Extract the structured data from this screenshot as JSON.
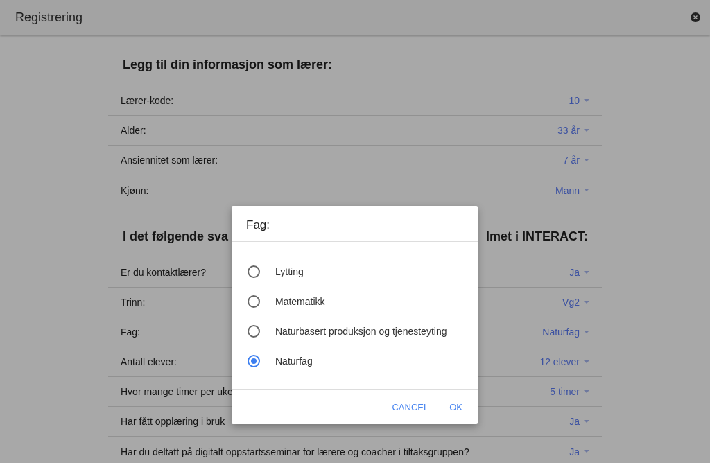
{
  "window": {
    "title": "Registrering"
  },
  "sections": [
    {
      "heading": [
        "Legg til din informasjon som lærer:"
      ],
      "rows": [
        {
          "label": "Lærer-kode:",
          "value": "10"
        },
        {
          "label": "Alder:",
          "value": "33 år"
        },
        {
          "label": "Ansiennitet som lærer:",
          "value": "7 år"
        },
        {
          "label": "Kjønn:",
          "value": "Mann"
        }
      ]
    },
    {
      "heading": [
        "I det følgende sva",
        "lmet i INTERACT:"
      ],
      "rows": [
        {
          "label": "Er du kontaktlærer?",
          "value": "Ja"
        },
        {
          "label": "Trinn:",
          "value": "Vg2"
        },
        {
          "label": "Fag:",
          "value": "Naturfag"
        },
        {
          "label": "Antall elever:",
          "value": "12 elever"
        },
        {
          "label": "Hvor mange timer per uke",
          "value": "5 timer"
        },
        {
          "label": "Har fått opplæring i bruk",
          "value": "Ja"
        },
        {
          "label": "Har du deltatt på digitalt oppstartsseminar for lærere og coacher i tiltaksgruppen?",
          "value": "Ja"
        }
      ]
    }
  ],
  "dialog": {
    "title": "Fag:",
    "options": [
      {
        "label": "Lytting",
        "selected": false
      },
      {
        "label": "Matematikk",
        "selected": false
      },
      {
        "label": "Naturbasert produksjon og tjenesteyting",
        "selected": false
      },
      {
        "label": "Naturfag",
        "selected": true
      }
    ],
    "buttons": [
      "CANCEL",
      "OK"
    ]
  }
}
